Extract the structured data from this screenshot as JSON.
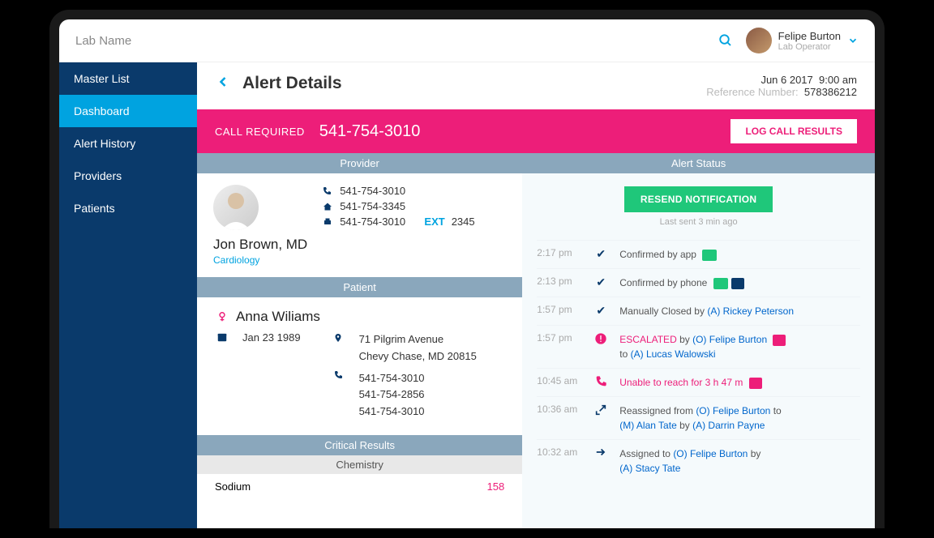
{
  "topbar": {
    "lab_name": "Lab Name",
    "user_name": "Felipe Burton",
    "user_role": "Lab Operator"
  },
  "sidebar": {
    "items": [
      {
        "label": "Master List",
        "active": false
      },
      {
        "label": "Dashboard",
        "active": true
      },
      {
        "label": "Alert History",
        "active": false
      },
      {
        "label": "Providers",
        "active": false
      },
      {
        "label": "Patients",
        "active": false
      }
    ]
  },
  "page": {
    "title": "Alert Details",
    "date": "Jun 6 2017",
    "time": "9:00 am",
    "ref_label": "Reference Number:",
    "ref_num": "578386212"
  },
  "call_bar": {
    "label": "CALL REQUIRED",
    "phone": "541-754-3010",
    "button": "LOG CALL RESULTS"
  },
  "sections": {
    "provider": "Provider",
    "patient": "Patient",
    "alert_status": "Alert Status",
    "critical": "Critical Results",
    "chemistry": "Chemistry"
  },
  "provider": {
    "name": "Jon Brown, MD",
    "specialty": "Cardiology",
    "contacts": [
      {
        "icon": "phone",
        "value": "541-754-3010"
      },
      {
        "icon": "home",
        "value": "541-754-3345"
      },
      {
        "icon": "fax",
        "value": "541-754-3010",
        "ext_label": "EXT",
        "ext": "2345"
      }
    ]
  },
  "patient": {
    "name": "Anna Wiliams",
    "dob": "Jan 23 1989",
    "address1": "71 Pilgrim Avenue",
    "address2": "Chevy Chase, MD 20815",
    "phones": [
      "541-754-3010",
      "541-754-2856",
      "541-754-3010"
    ]
  },
  "critical_results": [
    {
      "name": "Sodium",
      "value": "158"
    }
  ],
  "alert_status": {
    "resend_btn": "RESEND NOTIFICATION",
    "last_sent": "Last sent 3 min ago",
    "timeline": [
      {
        "time": "2:17 pm",
        "icon": "check",
        "html": "Confirmed by app",
        "badge": "doc"
      },
      {
        "time": "2:13 pm",
        "icon": "check",
        "html": "Confirmed by phone",
        "badge": "doc-comment"
      },
      {
        "time": "1:57 pm",
        "icon": "check",
        "text": "Manually Closed by",
        "link": "(A) Rickey Peterson"
      },
      {
        "time": "1:57 pm",
        "icon": "alert",
        "escalated": true,
        "by": "(O) Felipe Burton",
        "to": "(A) Lucas Walowski",
        "badge": "pink"
      },
      {
        "time": "10:45 am",
        "icon": "phone-miss",
        "red_text": "Unable to reach for 3 h 47 m",
        "badge": "pink"
      },
      {
        "time": "10:36 am",
        "icon": "reassign",
        "reassign_from": "(O) Felipe Burton",
        "reassign_to": "(M) Alan Tate",
        "reassign_by": "(A) Darrin Payne"
      },
      {
        "time": "10:32 am",
        "icon": "arrow",
        "assigned_to": "(O) Felipe Burton",
        "assigned_by": "(A) Stacy Tate"
      }
    ]
  }
}
